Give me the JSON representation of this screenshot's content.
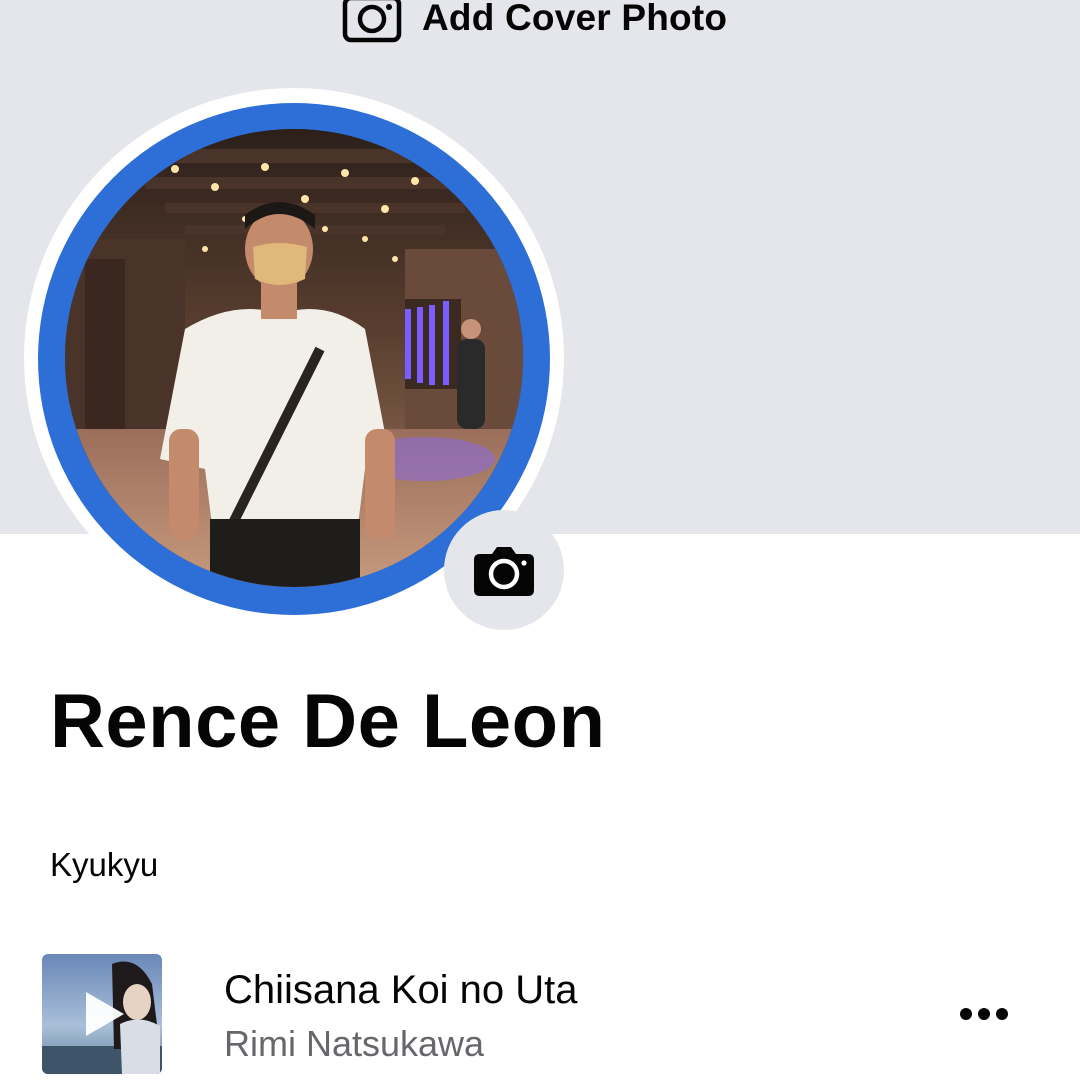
{
  "cover": {
    "add_cover_label": "Add Cover Photo",
    "add_cover_icon": "camera-outline-icon",
    "background_color": "#e4e6eb"
  },
  "avatar": {
    "ring_color": "#2d6fd6",
    "edit_icon": "camera-icon"
  },
  "profile": {
    "name": "Rence De Leon",
    "bio": "Kyukyu"
  },
  "music": {
    "title": "Chiisana Koi no Uta",
    "artist": "Rimi Natsukawa",
    "play_icon": "play-icon",
    "more_icon": "more-horizontal-icon"
  },
  "colors": {
    "text_primary": "#050505",
    "text_secondary": "#65676b",
    "accent_blue": "#2d6fd6"
  }
}
